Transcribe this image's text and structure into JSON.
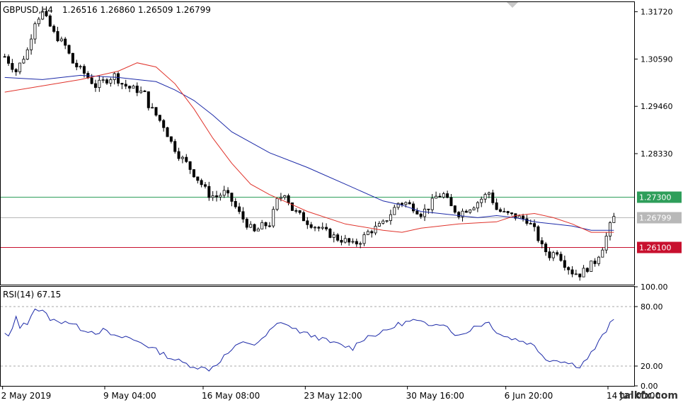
{
  "header": {
    "symbol_tf": "GBPUSD,H4",
    "ohlc": "1.26516  1.26860  1.26509  1.26799"
  },
  "rsi": {
    "label": "RSI(14) 67.15"
  },
  "watermark": "talkfx.com",
  "colors": {
    "candle": "#000000",
    "ma_fast": "#e0332b",
    "ma_slow": "#1c2aa8",
    "rsi": "#1c2aa8",
    "line_green": "#2e9e5a",
    "line_red": "#c8102e",
    "line_gray": "#b8b8b8",
    "frame": "#000000"
  },
  "chart_data": [
    {
      "type": "candlestick",
      "symbol": "GBPUSD",
      "timeframe": "H4",
      "ylim": [
        1.252,
        1.3195
      ],
      "yticks": [
        "1.31720",
        "1.30590",
        "1.29460",
        "1.28330"
      ],
      "xticks": [
        "2 May 2019",
        "9 May 04:00",
        "16 May 08:00",
        "23 May 12:00",
        "30 May 16:00",
        "6 Jun 20:00",
        "14 Jun 00:00"
      ],
      "levels": [
        {
          "price": 1.273,
          "label": "1.27300",
          "color": "#2e9e5a"
        },
        {
          "price": 1.26799,
          "label": "1.26799",
          "color": "#b8b8b8"
        },
        {
          "price": 1.261,
          "label": "1.26100",
          "color": "#c8102e"
        }
      ],
      "close_path": [
        [
          0,
          1.3065
        ],
        [
          3,
          1.303
        ],
        [
          6,
          1.308
        ],
        [
          8,
          1.315
        ],
        [
          10,
          1.317
        ],
        [
          13,
          1.312
        ],
        [
          16,
          1.309
        ],
        [
          18,
          1.305
        ],
        [
          21,
          1.3025
        ],
        [
          24,
          1.2995
        ],
        [
          27,
          1.301
        ],
        [
          29,
          1.302
        ],
        [
          31,
          1.3
        ],
        [
          33,
          1.299
        ],
        [
          35,
          1.2985
        ],
        [
          37,
          1.2975
        ],
        [
          38,
          1.295
        ],
        [
          40,
          1.2925
        ],
        [
          42,
          1.29
        ],
        [
          44,
          1.286
        ],
        [
          46,
          1.283
        ],
        [
          48,
          1.281
        ],
        [
          50,
          1.2785
        ],
        [
          52,
          1.276
        ],
        [
          54,
          1.2735
        ],
        [
          56,
          1.273
        ],
        [
          58,
          1.274
        ],
        [
          60,
          1.272
        ],
        [
          62,
          1.269
        ],
        [
          64,
          1.2665
        ],
        [
          66,
          1.2645
        ],
        [
          68,
          1.266
        ],
        [
          70,
          1.2665
        ],
        [
          72,
          1.272
        ],
        [
          74,
          1.274
        ],
        [
          76,
          1.27
        ],
        [
          78,
          1.2685
        ],
        [
          80,
          1.267
        ],
        [
          82,
          1.266
        ],
        [
          84,
          1.265
        ],
        [
          86,
          1.264
        ],
        [
          88,
          1.263
        ],
        [
          90,
          1.2625
        ],
        [
          92,
          1.2615
        ],
        [
          94,
          1.2625
        ],
        [
          96,
          1.2645
        ],
        [
          98,
          1.2655
        ],
        [
          100,
          1.2665
        ],
        [
          102,
          1.269
        ],
        [
          104,
          1.2715
        ],
        [
          106,
          1.2715
        ],
        [
          108,
          1.2705
        ],
        [
          110,
          1.269
        ],
        [
          112,
          1.2705
        ],
        [
          114,
          1.273
        ],
        [
          116,
          1.2735
        ],
        [
          118,
          1.2705
        ],
        [
          120,
          1.269
        ],
        [
          122,
          1.27
        ],
        [
          124,
          1.271
        ],
        [
          126,
          1.2725
        ],
        [
          128,
          1.274
        ],
        [
          130,
          1.27
        ],
        [
          132,
          1.269
        ],
        [
          134,
          1.2685
        ],
        [
          136,
          1.268
        ],
        [
          138,
          1.2675
        ],
        [
          140,
          1.265
        ],
        [
          142,
          1.261
        ],
        [
          144,
          1.259
        ],
        [
          146,
          1.26
        ],
        [
          148,
          1.257
        ],
        [
          150,
          1.255
        ],
        [
          152,
          1.2545
        ],
        [
          154,
          1.256
        ],
        [
          156,
          1.2575
        ],
        [
          158,
          1.261
        ],
        [
          160,
          1.266
        ],
        [
          161,
          1.268
        ]
      ],
      "ma_fast_path": [
        [
          0,
          1.298
        ],
        [
          10,
          1.2995
        ],
        [
          20,
          1.301
        ],
        [
          30,
          1.303
        ],
        [
          35,
          1.305
        ],
        [
          40,
          1.304
        ],
        [
          45,
          1.3
        ],
        [
          50,
          1.294
        ],
        [
          55,
          1.287
        ],
        [
          60,
          1.281
        ],
        [
          65,
          1.276
        ],
        [
          70,
          1.2735
        ],
        [
          75,
          1.2715
        ],
        [
          80,
          1.2695
        ],
        [
          90,
          1.2665
        ],
        [
          100,
          1.265
        ],
        [
          105,
          1.2645
        ],
        [
          110,
          1.2655
        ],
        [
          120,
          1.2665
        ],
        [
          130,
          1.267
        ],
        [
          135,
          1.2685
        ],
        [
          140,
          1.269
        ],
        [
          145,
          1.268
        ],
        [
          150,
          1.2665
        ],
        [
          155,
          1.2645
        ],
        [
          161,
          1.2645
        ]
      ],
      "ma_slow_path": [
        [
          0,
          1.3015
        ],
        [
          10,
          1.301
        ],
        [
          20,
          1.302
        ],
        [
          30,
          1.3015
        ],
        [
          35,
          1.301
        ],
        [
          40,
          1.3005
        ],
        [
          45,
          1.2985
        ],
        [
          50,
          1.296
        ],
        [
          55,
          1.2925
        ],
        [
          60,
          1.2885
        ],
        [
          70,
          1.2835
        ],
        [
          80,
          1.28
        ],
        [
          90,
          1.276
        ],
        [
          100,
          1.272
        ],
        [
          105,
          1.271
        ],
        [
          110,
          1.2695
        ],
        [
          115,
          1.269
        ],
        [
          120,
          1.2685
        ],
        [
          125,
          1.268
        ],
        [
          130,
          1.2685
        ],
        [
          135,
          1.268
        ],
        [
          140,
          1.267
        ],
        [
          145,
          1.2665
        ],
        [
          150,
          1.266
        ],
        [
          155,
          1.265
        ],
        [
          161,
          1.265
        ]
      ]
    },
    {
      "type": "line",
      "name": "RSI(14)",
      "ylim": [
        0,
        100
      ],
      "yticks": [
        "100.00",
        "80.00",
        "20.00",
        "0.00"
      ],
      "levels": [
        80,
        20
      ],
      "rsi_path": [
        [
          0,
          0.52
        ],
        [
          1,
          0.5
        ],
        [
          2,
          0.56
        ],
        [
          3,
          0.7
        ],
        [
          4,
          0.6
        ],
        [
          6,
          0.63
        ],
        [
          7,
          0.73
        ],
        [
          8,
          0.78
        ],
        [
          10,
          0.75
        ],
        [
          12,
          0.68
        ],
        [
          14,
          0.64
        ],
        [
          16,
          0.66
        ],
        [
          18,
          0.62
        ],
        [
          20,
          0.58
        ],
        [
          22,
          0.56
        ],
        [
          24,
          0.54
        ],
        [
          26,
          0.56
        ],
        [
          28,
          0.52
        ],
        [
          30,
          0.48
        ],
        [
          32,
          0.5
        ],
        [
          34,
          0.46
        ],
        [
          36,
          0.44
        ],
        [
          38,
          0.4
        ],
        [
          40,
          0.36
        ],
        [
          42,
          0.32
        ],
        [
          44,
          0.28
        ],
        [
          46,
          0.25
        ],
        [
          48,
          0.22
        ],
        [
          50,
          0.2
        ],
        [
          52,
          0.18
        ],
        [
          54,
          0.17
        ],
        [
          56,
          0.22
        ],
        [
          58,
          0.3
        ],
        [
          60,
          0.36
        ],
        [
          62,
          0.42
        ],
        [
          64,
          0.44
        ],
        [
          66,
          0.42
        ],
        [
          68,
          0.46
        ],
        [
          70,
          0.55
        ],
        [
          72,
          0.62
        ],
        [
          74,
          0.64
        ],
        [
          76,
          0.58
        ],
        [
          78,
          0.55
        ],
        [
          80,
          0.52
        ],
        [
          82,
          0.5
        ],
        [
          84,
          0.47
        ],
        [
          86,
          0.44
        ],
        [
          88,
          0.42
        ],
        [
          90,
          0.4
        ],
        [
          92,
          0.38
        ],
        [
          94,
          0.46
        ],
        [
          96,
          0.5
        ],
        [
          98,
          0.52
        ],
        [
          100,
          0.54
        ],
        [
          102,
          0.58
        ],
        [
          104,
          0.62
        ],
        [
          106,
          0.64
        ],
        [
          108,
          0.66
        ],
        [
          110,
          0.64
        ],
        [
          112,
          0.6
        ],
        [
          114,
          0.64
        ],
        [
          116,
          0.63
        ],
        [
          118,
          0.56
        ],
        [
          120,
          0.5
        ],
        [
          122,
          0.54
        ],
        [
          124,
          0.6
        ],
        [
          126,
          0.62
        ],
        [
          128,
          0.64
        ],
        [
          130,
          0.55
        ],
        [
          132,
          0.5
        ],
        [
          134,
          0.48
        ],
        [
          136,
          0.46
        ],
        [
          138,
          0.44
        ],
        [
          140,
          0.4
        ],
        [
          142,
          0.32
        ],
        [
          144,
          0.25
        ],
        [
          146,
          0.27
        ],
        [
          148,
          0.24
        ],
        [
          150,
          0.22
        ],
        [
          152,
          0.2
        ],
        [
          154,
          0.28
        ],
        [
          156,
          0.38
        ],
        [
          158,
          0.5
        ],
        [
          160,
          0.62
        ],
        [
          161,
          0.6715
        ]
      ]
    }
  ]
}
